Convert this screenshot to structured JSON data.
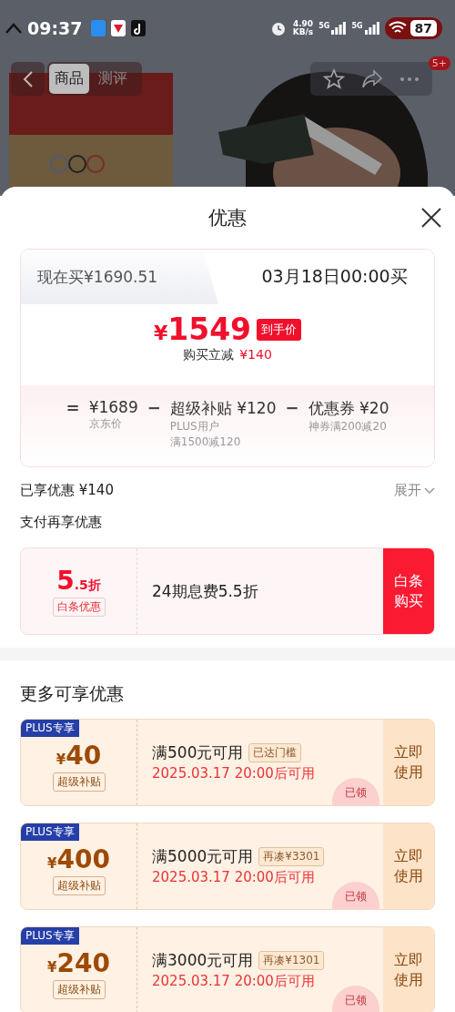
{
  "status_bar": {
    "time": "09:37",
    "net_speed": "4.90",
    "net_unit": "KB/s",
    "signals": [
      "5G",
      "5G"
    ],
    "battery": "87"
  },
  "nav": {
    "tabs": [
      {
        "label": "商品",
        "selected": true
      },
      {
        "label": "测评",
        "selected": false
      }
    ],
    "badge": "5+"
  },
  "sheet": {
    "title": "优惠"
  },
  "price_card": {
    "modes": [
      {
        "label": "现在买¥1690.51",
        "selected": false
      },
      {
        "label": "03月18日00:00买",
        "selected": true
      }
    ],
    "currency": "¥",
    "price": "1549",
    "price_tag": "到手价",
    "saving_label": "购买立减",
    "saving": "¥140",
    "breakdown": [
      {
        "op": "=",
        "amount": "¥1689",
        "notes": [
          "京东价"
        ]
      },
      {
        "op": "−",
        "amount": "超级补贴 ¥120",
        "notes": [
          "PLUS用户",
          "满1500减120"
        ]
      },
      {
        "op": "−",
        "amount": "优惠券 ¥20",
        "notes": [
          "神券满200减20"
        ]
      }
    ]
  },
  "summary": {
    "label": "已享优惠 ¥140",
    "toggle": "展开"
  },
  "payment": {
    "heading": "支付再享优惠",
    "value_main": "5",
    "value_suffix": ".5折",
    "tag": "白条优惠",
    "description": "24期息费5.5折",
    "action": "白条购买"
  },
  "more": {
    "heading": "更多可享优惠",
    "coupons": [
      {
        "badge": "PLUS专享",
        "currency": "¥",
        "amount": "40",
        "tag": "超级补贴",
        "condition": "满500元可用",
        "chip": "已达门槛",
        "time": "2025.03.17 20:00后可用",
        "action": "立即使用",
        "stamp": "已领"
      },
      {
        "badge": "PLUS专享",
        "currency": "¥",
        "amount": "400",
        "tag": "超级补贴",
        "condition": "满5000元可用",
        "chip": "再凑¥3301",
        "time": "2025.03.17 20:00后可用",
        "action": "立即使用",
        "stamp": "已领"
      },
      {
        "badge": "PLUS专享",
        "currency": "¥",
        "amount": "240",
        "tag": "超级补贴",
        "condition": "满3000元可用",
        "chip": "再凑¥1301",
        "time": "2025.03.17 20:00后可用",
        "action": "立即使用",
        "stamp": "已领"
      }
    ]
  }
}
